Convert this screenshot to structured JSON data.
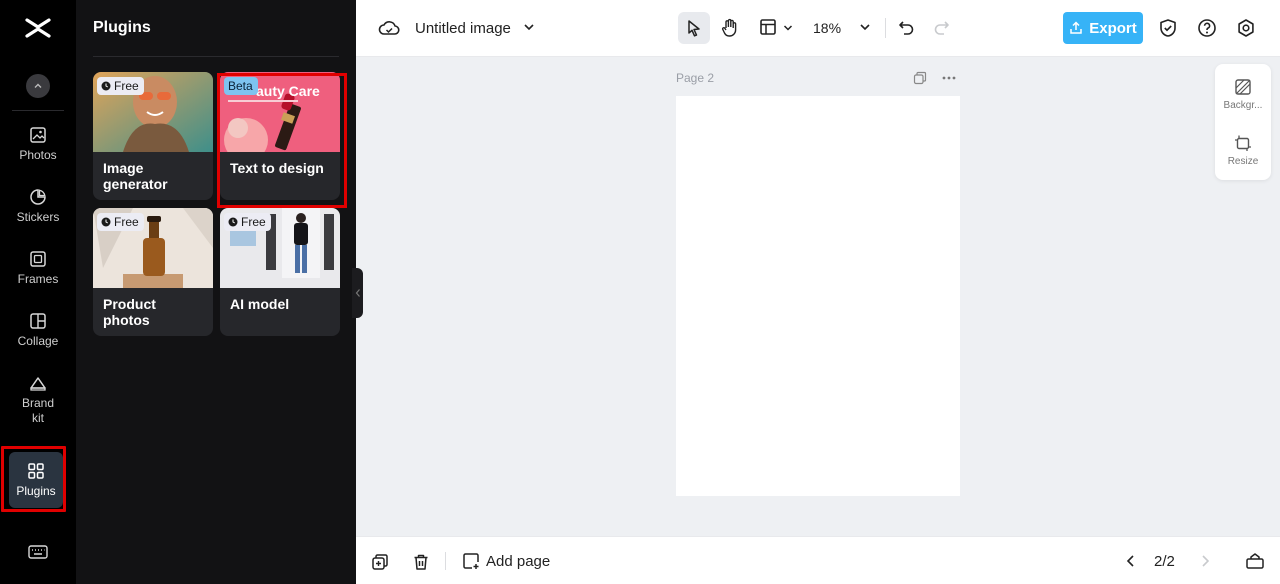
{
  "sidebar": {
    "items": [
      {
        "label": "Photos",
        "icon": "image-icon"
      },
      {
        "label": "Stickers",
        "icon": "sticker-icon"
      },
      {
        "label": "Frames",
        "icon": "frame-icon"
      },
      {
        "label": "Collage",
        "icon": "collage-icon"
      },
      {
        "label": "Brand\nkit",
        "icon": "brand-kit-icon"
      },
      {
        "label": "Plugins",
        "icon": "grid-icon"
      }
    ]
  },
  "panel": {
    "title": "Plugins",
    "cards": [
      {
        "label": "Image generator",
        "badge": "Free"
      },
      {
        "label": "Text to design",
        "badge": "Beta",
        "overlay": "auty Care"
      },
      {
        "label": "Product photos",
        "badge": "Free"
      },
      {
        "label": "AI model",
        "badge": "Free"
      }
    ]
  },
  "topbar": {
    "title": "Untitled image",
    "zoom": "18%",
    "export_label": "Export"
  },
  "canvas": {
    "page_label": "Page 2"
  },
  "side_panel": {
    "background_label": "Backgr...",
    "resize_label": "Resize"
  },
  "bottombar": {
    "add_page_label": "Add page",
    "page_indicator": "2/2"
  },
  "colors": {
    "accent": "#36b3f7",
    "highlight": "#e00000"
  }
}
